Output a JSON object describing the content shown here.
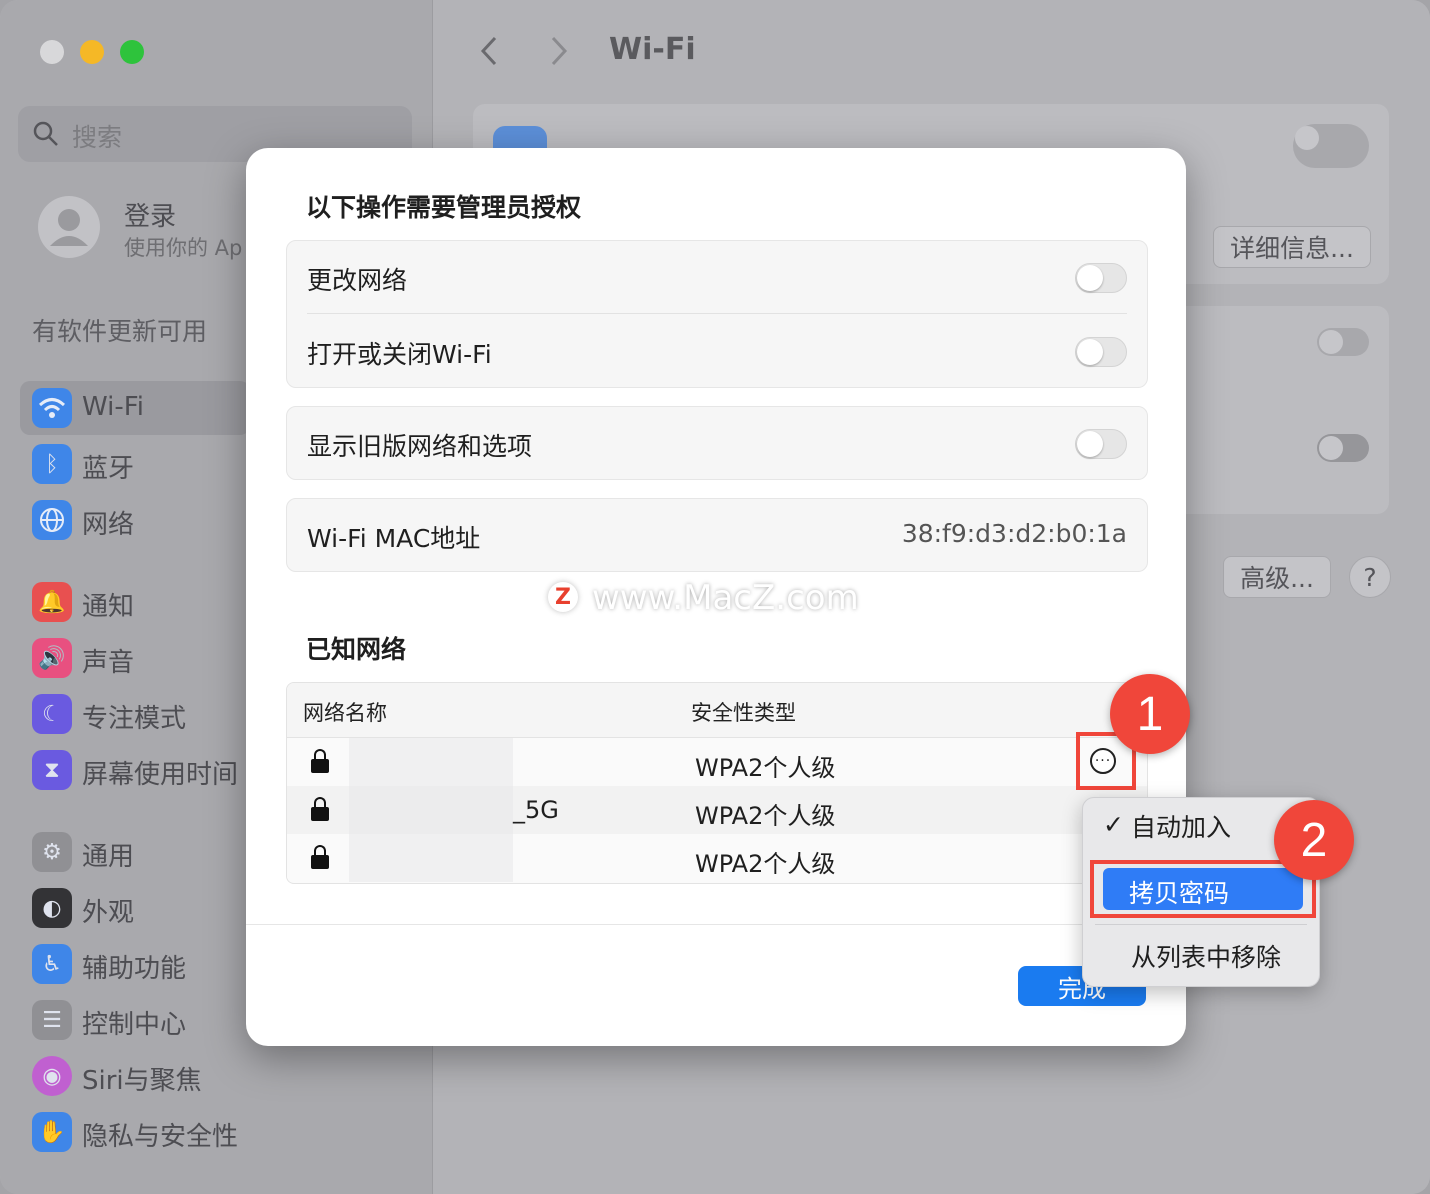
{
  "window": {
    "title": "Wi-Fi",
    "traffic_lights": [
      "#d8d8da",
      "#f5b826",
      "#2ec33c"
    ]
  },
  "sidebar": {
    "search_placeholder": "搜索",
    "account": {
      "name": "登录",
      "subtitle": "使用你的 Ap"
    },
    "update_notice": "有软件更新可用",
    "items": [
      {
        "label": "Wi-Fi",
        "icon": "wifi-icon",
        "color": "#3f86e8"
      },
      {
        "label": "蓝牙",
        "icon": "bluetooth-icon",
        "color": "#3f86e8"
      },
      {
        "label": "网络",
        "icon": "globe-icon",
        "color": "#3f86e8"
      },
      {
        "label": "通知",
        "icon": "bell-icon",
        "color": "#e85050"
      },
      {
        "label": "声音",
        "icon": "speaker-icon",
        "color": "#e85080"
      },
      {
        "label": "专注模式",
        "icon": "moon-icon",
        "color": "#6a5ae0"
      },
      {
        "label": "屏幕使用时间",
        "icon": "hourglass-icon",
        "color": "#6a5ae0"
      },
      {
        "label": "通用",
        "icon": "gear-icon",
        "color": "#909094"
      },
      {
        "label": "外观",
        "icon": "appearance-icon",
        "color": "#333336"
      },
      {
        "label": "辅助功能",
        "icon": "accessibility-icon",
        "color": "#3f86e8"
      },
      {
        "label": "控制中心",
        "icon": "toggles-icon",
        "color": "#909094"
      },
      {
        "label": "Siri与聚焦",
        "icon": "siri-icon",
        "color": "#c060d0"
      },
      {
        "label": "隐私与安全性",
        "icon": "hand-icon",
        "color": "#3f86e8"
      }
    ]
  },
  "content": {
    "details_button": "详细信息...",
    "advanced_button": "高级...",
    "help_button": "?"
  },
  "dialog": {
    "admin_title": "以下操作需要管理员授权",
    "rows": [
      {
        "label": "更改网络",
        "on": false
      },
      {
        "label": "打开或关闭Wi-Fi",
        "on": false
      }
    ],
    "legacy": {
      "label": "显示旧版网络和选项",
      "on": false
    },
    "mac": {
      "label": "Wi-Fi MAC地址",
      "value": "38:f9:d3:d2:b0:1a"
    },
    "watermark": "www.MacZ.com",
    "known_title": "已知网络",
    "table": {
      "headers": [
        "网络名称",
        "安全性类型"
      ],
      "rows": [
        {
          "name": "",
          "security": "WPA2个人级"
        },
        {
          "name": "_5G",
          "security": "WPA2个人级"
        },
        {
          "name": "",
          "security": "WPA2个人级"
        }
      ]
    },
    "done_button": "完成"
  },
  "context_menu": {
    "items": [
      {
        "label": "自动加入",
        "checked": true,
        "check": "✓"
      },
      {
        "label": "拷贝密码",
        "highlighted": true
      },
      {
        "label": "从列表中移除"
      }
    ]
  },
  "annotations": {
    "badge1": "1",
    "badge2": "2"
  }
}
